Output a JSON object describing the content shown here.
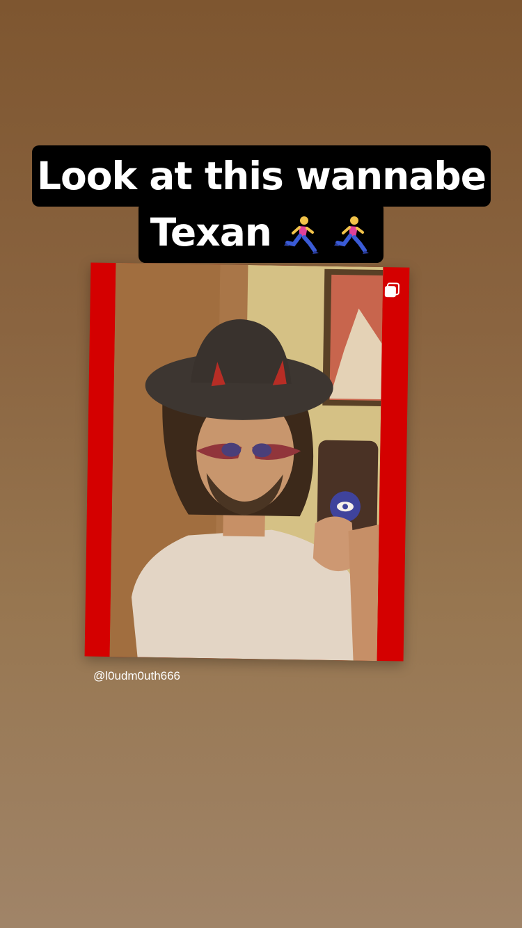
{
  "story": {
    "caption_line1": "Look at this wannabe",
    "caption_line2": "Texan",
    "caption_emoji": [
      "person-running-emoji",
      "person-running-emoji"
    ],
    "post_username": "@l0udm0uth666",
    "frame_color": "#d40000",
    "caption_bg": "#000000",
    "caption_color": "#ffffff"
  }
}
